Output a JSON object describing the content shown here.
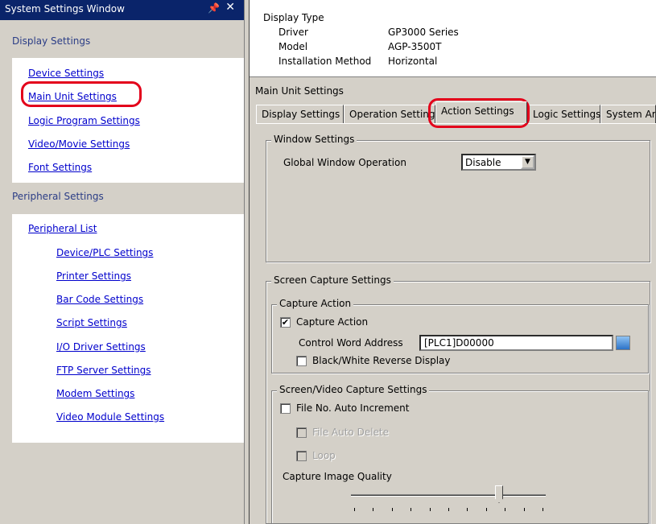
{
  "window": {
    "title": "System Settings Window",
    "pin_glyph": "Ͱ",
    "close_glyph": "✕"
  },
  "left_panel": {
    "display_settings": {
      "header": "Display Settings",
      "items": [
        "Device Settings",
        "Main Unit Settings",
        "Logic Program Settings",
        "Video/Movie Settings",
        "Font Settings"
      ]
    },
    "peripheral_settings": {
      "header": "Peripheral Settings",
      "list_link": "Peripheral List",
      "items": [
        "Device/PLC Settings",
        "Printer Settings",
        "Bar Code Settings",
        "Script Settings",
        "I/O Driver Settings",
        "FTP Server Settings",
        "Modem Settings",
        "Video Module Settings"
      ]
    }
  },
  "display_type": {
    "header": "Display Type",
    "rows": [
      {
        "label": "Driver",
        "value": "GP3000 Series"
      },
      {
        "label": "Model",
        "value": "AGP-3500T"
      },
      {
        "label": "Installation Method",
        "value": "Horizontal"
      }
    ]
  },
  "main_unit": {
    "header": "Main Unit Settings",
    "tabs": [
      "Display Settings",
      "Operation Settings",
      "Action Settings",
      "Logic Settings",
      "System Area"
    ],
    "active_tab": "Action Settings"
  },
  "window_settings": {
    "group_label": "Window Settings",
    "global_window_operation_label": "Global Window Operation",
    "global_window_operation_value": "Disable"
  },
  "screen_capture": {
    "group_label": "Screen Capture Settings",
    "capture_action_group": "Capture Action",
    "capture_action_checkbox": "Capture Action",
    "capture_action_checked": true,
    "control_word_label": "Control Word Address",
    "control_word_value": "[PLC1]D00000",
    "bw_reverse_label": "Black/White Reverse Display",
    "bw_reverse_checked": false,
    "screen_video_group": "Screen/Video Capture Settings",
    "file_auto_increment": "File No. Auto Increment",
    "file_auto_delete": "File Auto Delete",
    "loop": "Loop",
    "image_quality_label": "Capture Image Quality",
    "image_quality_level": 0.77
  },
  "colors": {
    "highlight": "#e3001b",
    "title_bar": "#0a246a",
    "link": "#0000cc",
    "panel": "#d4d0c8"
  }
}
